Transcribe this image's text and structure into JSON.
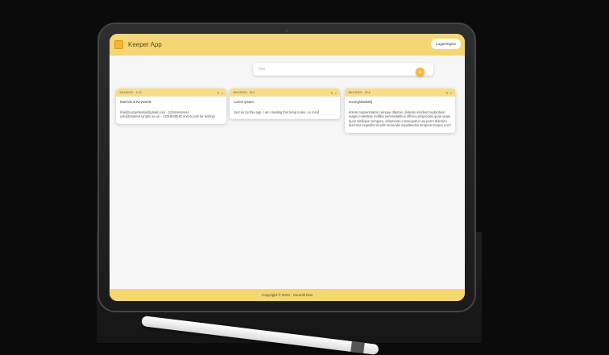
{
  "app": {
    "title": "Keeper App",
    "login_label": "Login/Signin"
  },
  "create": {
    "placeholder": "Title",
    "add_label": "+"
  },
  "notes": [
    {
      "date": "15/1/2023 - 1:13",
      "title": "Mail Ids & Keywords",
      "body": "liza@louzamledos@gmail.com - 1234HAHAHA\nxxfo@student.london.ac.uk - 123HEHEHE and its just for testing!"
    },
    {
      "date": "15/1/2023 - 15:1",
      "title": "Lorem ipsum",
      "body": "Just on try this app. I am creating this temp notes, no mind"
    },
    {
      "date": "15/1/2023 - 15:4",
      "title": "someglobekabj",
      "body": "dolum capserimatus cumque ditertos, distenis incidunt laudantium magni molestiae mollitia necessitatibus officiis perspiciatis quae quasi quos similique sempore, dolumento consequatur uar porro dolorum ducimus expedita sit velit reiciendis expellendus tempora tempor eos?"
    }
  ],
  "footer": {
    "copyright": "Copyright © 2023 - Soumik Das"
  },
  "icons": {
    "logo": "keeper-logo-icon",
    "add": "plus-icon",
    "edit": "edit-icon",
    "delete": "delete-icon"
  },
  "colors": {
    "accent": "#f5d675",
    "note_header": "#f7dd8a",
    "button": "#f5b942"
  }
}
